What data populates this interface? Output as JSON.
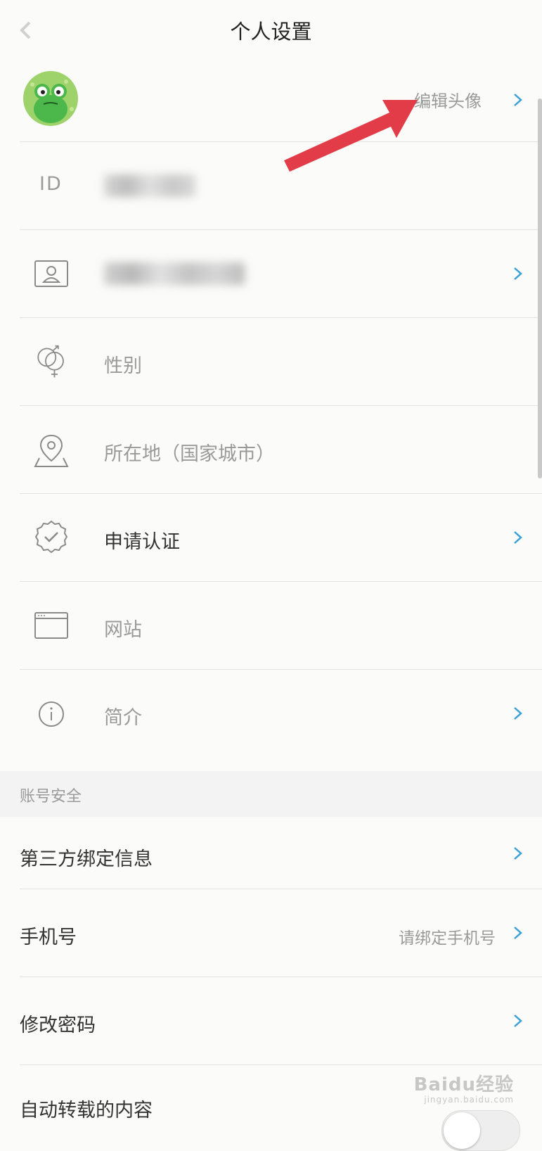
{
  "header": {
    "title": "个人设置"
  },
  "profile": {
    "edit_avatar_label": "编辑头像",
    "id_label": "ID"
  },
  "fields": {
    "gender": "性别",
    "location": "所在地（国家城市）",
    "verify": "申请认证",
    "website": "网站",
    "bio": "简介"
  },
  "account_security": {
    "section_title": "账号安全",
    "third_party": "第三方绑定信息",
    "phone_label": "手机号",
    "phone_value": "请绑定手机号",
    "change_password": "修改密码",
    "partial_row": "自动转载的内容"
  },
  "watermark": {
    "brand": "Baidu经验",
    "url": "jingyan.baidu.com"
  },
  "colors": {
    "accent": "#3aa0d8",
    "arrow": "#e23c48",
    "avatar_bg": "#9ed36b"
  }
}
